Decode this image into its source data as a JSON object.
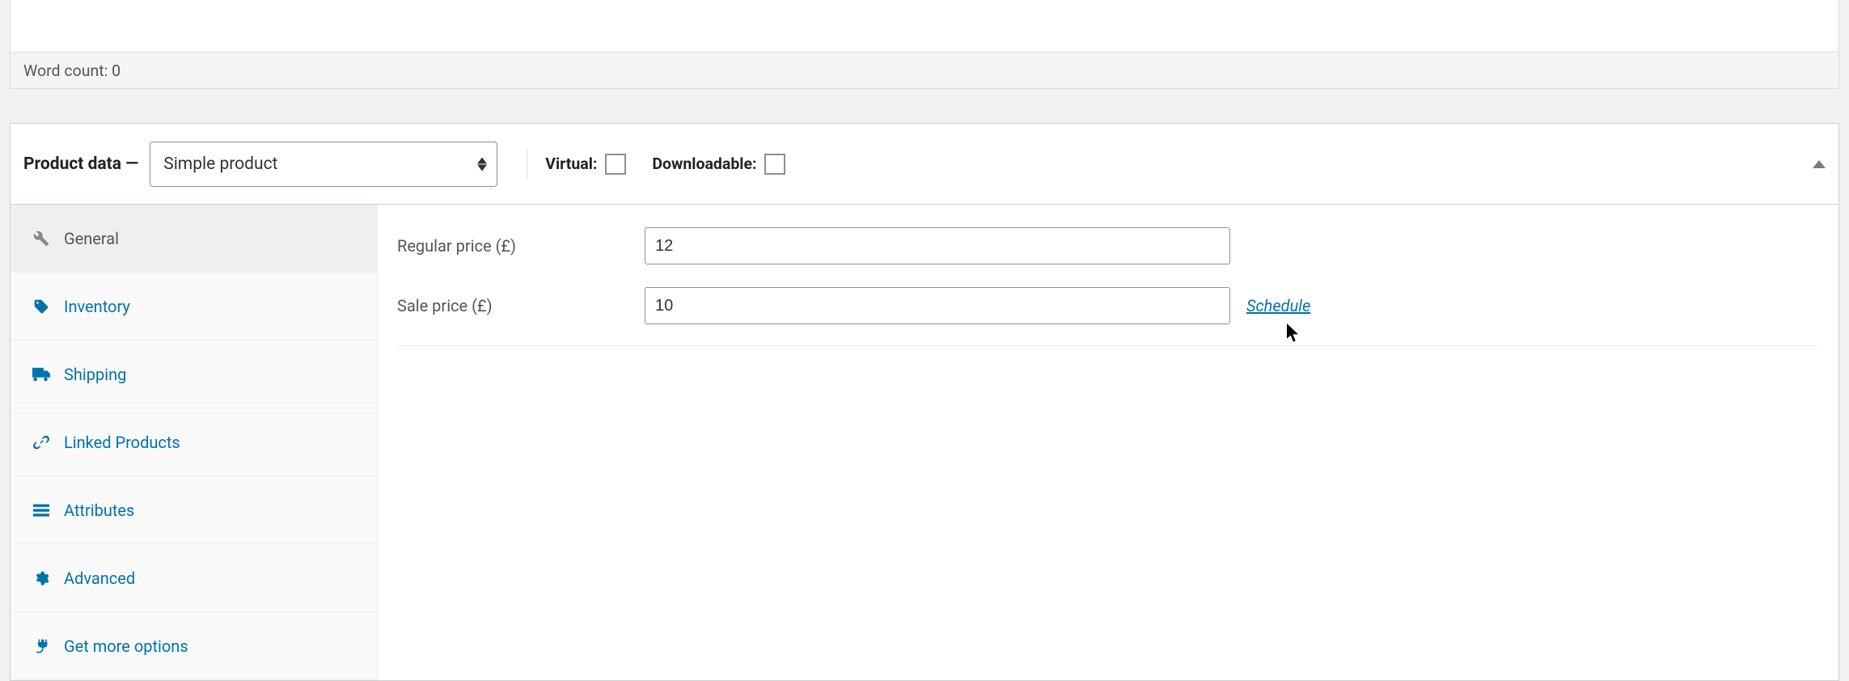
{
  "editor": {
    "word_count_label": "Word count: 0"
  },
  "product_data": {
    "title": "Product data —",
    "type_select": "Simple product",
    "virtual_label": "Virtual:",
    "downloadable_label": "Downloadable:",
    "tabs": [
      {
        "label": "General"
      },
      {
        "label": "Inventory"
      },
      {
        "label": "Shipping"
      },
      {
        "label": "Linked Products"
      },
      {
        "label": "Attributes"
      },
      {
        "label": "Advanced"
      },
      {
        "label": "Get more options"
      }
    ],
    "fields": {
      "regular_price_label": "Regular price (£)",
      "regular_price_value": "12",
      "sale_price_label": "Sale price (£)",
      "sale_price_value": "10",
      "schedule_label": "Schedule"
    }
  }
}
